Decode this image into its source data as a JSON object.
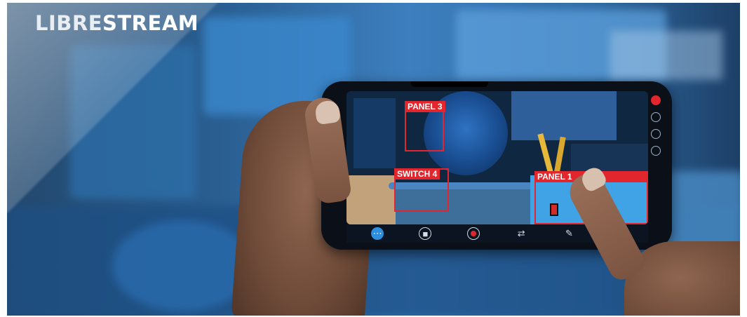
{
  "brand": {
    "name_light": "LIBRE",
    "name_bold": "STREAM"
  },
  "ar_labels": {
    "panel3": "PANEL 3",
    "switch4": "SWITCH 4",
    "panel1": "PANEL 1"
  },
  "side_icons": [
    "record-dot-icon",
    "microphone-icon",
    "settings-icon",
    "copy-icon"
  ],
  "toolbar_icons": [
    "menu-dots-icon",
    "stop-icon",
    "record-icon",
    "sliders-icon",
    "pencil-icon",
    "zoom-icon"
  ],
  "colors": {
    "ar_red": "#e1262d",
    "accent_blue": "#2c8fe0"
  }
}
